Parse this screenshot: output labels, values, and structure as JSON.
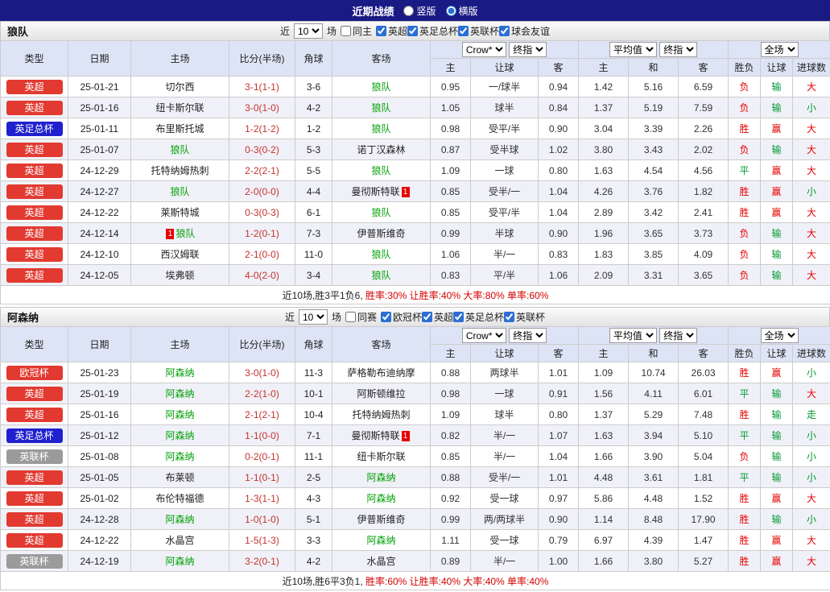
{
  "topbar": {
    "title": "近期战绩",
    "layout_options": [
      {
        "label": "竖版",
        "selected": false
      },
      {
        "label": "横版",
        "selected": true
      }
    ]
  },
  "palette": {
    "red": "#e60000",
    "green": "#009933",
    "badge_red": "#e23a31",
    "badge_blue": "#2020cf",
    "badge_gray": "#9b9b9b",
    "focus_team_green": "#00a006",
    "score_red": "#c5322d",
    "topbar_bg": "#1a1a85",
    "green_values": [
      "平",
      "输",
      "小",
      "走"
    ]
  },
  "columns": {
    "type": "类型",
    "date": "日期",
    "home": "主场",
    "score": "比分(半场)",
    "corner": "角球",
    "away": "客场",
    "sub": [
      "主",
      "让球",
      "客",
      "主",
      "和",
      "客",
      "胜负",
      "让球",
      "进球数"
    ],
    "selects": {
      "odds": "Crow*",
      "odds_final": "终指",
      "avg": "平均值",
      "avg_final": "终指",
      "full": "全场"
    }
  },
  "sections": [
    {
      "team": "狼队",
      "filters": {
        "prefix": "近",
        "count": "10",
        "suffix": "场",
        "same": {
          "label": "同主",
          "checked": false
        },
        "leagues": [
          {
            "label": "英超",
            "checked": true
          },
          {
            "label": "英足总杯",
            "checked": true
          },
          {
            "label": "英联杯",
            "checked": true
          },
          {
            "label": "球会友谊",
            "checked": true
          }
        ]
      },
      "rows": [
        {
          "league": "英超",
          "badge": "red",
          "date": "25-01-21",
          "home": "切尔西",
          "home_focus": false,
          "score": "3-1(1-1)",
          "corner": "3-6",
          "away": "狼队",
          "away_focus": true,
          "odds": [
            "0.95",
            "一/球半",
            "0.94"
          ],
          "avg": [
            "1.42",
            "5.16",
            "6.59"
          ],
          "results": [
            "负",
            "输",
            "大"
          ]
        },
        {
          "league": "英超",
          "badge": "red",
          "date": "25-01-16",
          "home": "纽卡斯尔联",
          "home_focus": false,
          "score": "3-0(1-0)",
          "corner": "4-2",
          "away": "狼队",
          "away_focus": true,
          "odds": [
            "1.05",
            "球半",
            "0.84"
          ],
          "avg": [
            "1.37",
            "5.19",
            "7.59"
          ],
          "results": [
            "负",
            "输",
            "小"
          ]
        },
        {
          "league": "英足总杯",
          "badge": "blue",
          "date": "25-01-11",
          "home": "布里斯托城",
          "home_focus": false,
          "score": "1-2(1-2)",
          "corner": "1-2",
          "away": "狼队",
          "away_focus": true,
          "odds": [
            "0.98",
            "受平/半",
            "0.90"
          ],
          "avg": [
            "3.04",
            "3.39",
            "2.26"
          ],
          "results": [
            "胜",
            "赢",
            "大"
          ]
        },
        {
          "league": "英超",
          "badge": "red",
          "date": "25-01-07",
          "home": "狼队",
          "home_focus": true,
          "score": "0-3(0-2)",
          "corner": "5-3",
          "away": "诺丁汉森林",
          "away_focus": false,
          "odds": [
            "0.87",
            "受半球",
            "1.02"
          ],
          "avg": [
            "3.80",
            "3.43",
            "2.02"
          ],
          "results": [
            "负",
            "输",
            "大"
          ]
        },
        {
          "league": "英超",
          "badge": "red",
          "date": "24-12-29",
          "home": "托特纳姆热刺",
          "home_focus": false,
          "score": "2-2(2-1)",
          "corner": "5-5",
          "away": "狼队",
          "away_focus": true,
          "odds": [
            "1.09",
            "一球",
            "0.80"
          ],
          "avg": [
            "1.63",
            "4.54",
            "4.56"
          ],
          "results": [
            "平",
            "赢",
            "大"
          ]
        },
        {
          "league": "英超",
          "badge": "red",
          "date": "24-12-27",
          "home": "狼队",
          "home_focus": true,
          "score": "2-0(0-0)",
          "corner": "4-4",
          "away": "曼彻斯特联",
          "away_focus": false,
          "away_card": true,
          "odds": [
            "0.85",
            "受半/一",
            "1.04"
          ],
          "avg": [
            "4.26",
            "3.76",
            "1.82"
          ],
          "results": [
            "胜",
            "赢",
            "小"
          ]
        },
        {
          "league": "英超",
          "badge": "red",
          "date": "24-12-22",
          "home": "莱斯特城",
          "home_focus": false,
          "score": "0-3(0-3)",
          "corner": "6-1",
          "away": "狼队",
          "away_focus": true,
          "odds": [
            "0.85",
            "受平/半",
            "1.04"
          ],
          "avg": [
            "2.89",
            "3.42",
            "2.41"
          ],
          "results": [
            "胜",
            "赢",
            "大"
          ]
        },
        {
          "league": "英超",
          "badge": "red",
          "date": "24-12-14",
          "home": "狼队",
          "home_focus": true,
          "home_card_pre": true,
          "score": "1-2(0-1)",
          "corner": "7-3",
          "away": "伊普斯维奇",
          "away_focus": false,
          "odds": [
            "0.99",
            "半球",
            "0.90"
          ],
          "avg": [
            "1.96",
            "3.65",
            "3.73"
          ],
          "results": [
            "负",
            "输",
            "大"
          ]
        },
        {
          "league": "英超",
          "badge": "red",
          "date": "24-12-10",
          "home": "西汉姆联",
          "home_focus": false,
          "score": "2-1(0-0)",
          "corner": "11-0",
          "away": "狼队",
          "away_focus": true,
          "odds": [
            "1.06",
            "半/一",
            "0.83"
          ],
          "avg": [
            "1.83",
            "3.85",
            "4.09"
          ],
          "results": [
            "负",
            "输",
            "大"
          ]
        },
        {
          "league": "英超",
          "badge": "red",
          "date": "24-12-05",
          "home": "埃弗顿",
          "home_focus": false,
          "score": "4-0(2-0)",
          "corner": "3-4",
          "away": "狼队",
          "away_focus": true,
          "odds": [
            "0.83",
            "平/半",
            "1.06"
          ],
          "avg": [
            "2.09",
            "3.31",
            "3.65"
          ],
          "results": [
            "负",
            "输",
            "大"
          ]
        }
      ],
      "summary": [
        {
          "text": "近10场,胜3平1负6, ",
          "red": false
        },
        {
          "text": "胜率:30% ",
          "red": true
        },
        {
          "text": "让胜率:40% ",
          "red": true
        },
        {
          "text": "大率:80% ",
          "red": true
        },
        {
          "text": "单率:60%",
          "red": true
        }
      ]
    },
    {
      "team": "阿森纳",
      "filters": {
        "prefix": "近",
        "count": "10",
        "suffix": "场",
        "same": {
          "label": "同赛",
          "checked": false
        },
        "leagues": [
          {
            "label": "欧冠杯",
            "checked": true
          },
          {
            "label": "英超",
            "checked": true
          },
          {
            "label": "英足总杯",
            "checked": true
          },
          {
            "label": "英联杯",
            "checked": true
          }
        ]
      },
      "rows": [
        {
          "league": "欧冠杯",
          "badge": "red",
          "date": "25-01-23",
          "home": "阿森纳",
          "home_focus": true,
          "score": "3-0(1-0)",
          "corner": "11-3",
          "away": "萨格勒布迪纳摩",
          "away_focus": false,
          "odds": [
            "0.88",
            "两球半",
            "1.01"
          ],
          "avg": [
            "1.09",
            "10.74",
            "26.03"
          ],
          "results": [
            "胜",
            "赢",
            "小"
          ]
        },
        {
          "league": "英超",
          "badge": "red",
          "date": "25-01-19",
          "home": "阿森纳",
          "home_focus": true,
          "score": "2-2(1-0)",
          "corner": "10-1",
          "away": "阿斯顿维拉",
          "away_focus": false,
          "odds": [
            "0.98",
            "一球",
            "0.91"
          ],
          "avg": [
            "1.56",
            "4.11",
            "6.01"
          ],
          "results": [
            "平",
            "输",
            "大"
          ]
        },
        {
          "league": "英超",
          "badge": "red",
          "date": "25-01-16",
          "home": "阿森纳",
          "home_focus": true,
          "score": "2-1(2-1)",
          "corner": "10-4",
          "away": "托特纳姆热刺",
          "away_focus": false,
          "odds": [
            "1.09",
            "球半",
            "0.80"
          ],
          "avg": [
            "1.37",
            "5.29",
            "7.48"
          ],
          "results": [
            "胜",
            "输",
            "走"
          ]
        },
        {
          "league": "英足总杯",
          "badge": "blue",
          "date": "25-01-12",
          "home": "阿森纳",
          "home_focus": true,
          "score": "1-1(0-0)",
          "corner": "7-1",
          "away": "曼彻斯特联",
          "away_focus": false,
          "away_card": true,
          "odds": [
            "0.82",
            "半/一",
            "1.07"
          ],
          "avg": [
            "1.63",
            "3.94",
            "5.10"
          ],
          "results": [
            "平",
            "输",
            "小"
          ]
        },
        {
          "league": "英联杯",
          "badge": "gray",
          "date": "25-01-08",
          "home": "阿森纳",
          "home_focus": true,
          "score": "0-2(0-1)",
          "corner": "11-1",
          "away": "纽卡斯尔联",
          "away_focus": false,
          "odds": [
            "0.85",
            "半/一",
            "1.04"
          ],
          "avg": [
            "1.66",
            "3.90",
            "5.04"
          ],
          "results": [
            "负",
            "输",
            "小"
          ]
        },
        {
          "league": "英超",
          "badge": "red",
          "date": "25-01-05",
          "home": "布莱顿",
          "home_focus": false,
          "score": "1-1(0-1)",
          "corner": "2-5",
          "away": "阿森纳",
          "away_focus": true,
          "odds": [
            "0.88",
            "受半/一",
            "1.01"
          ],
          "avg": [
            "4.48",
            "3.61",
            "1.81"
          ],
          "results": [
            "平",
            "输",
            "小"
          ]
        },
        {
          "league": "英超",
          "badge": "red",
          "date": "25-01-02",
          "home": "布伦特福德",
          "home_focus": false,
          "score": "1-3(1-1)",
          "corner": "4-3",
          "away": "阿森纳",
          "away_focus": true,
          "odds": [
            "0.92",
            "受一球",
            "0.97"
          ],
          "avg": [
            "5.86",
            "4.48",
            "1.52"
          ],
          "results": [
            "胜",
            "赢",
            "大"
          ]
        },
        {
          "league": "英超",
          "badge": "red",
          "date": "24-12-28",
          "home": "阿森纳",
          "home_focus": true,
          "score": "1-0(1-0)",
          "corner": "5-1",
          "away": "伊普斯维奇",
          "away_focus": false,
          "odds": [
            "0.99",
            "两/两球半",
            "0.90"
          ],
          "avg": [
            "1.14",
            "8.48",
            "17.90"
          ],
          "results": [
            "胜",
            "输",
            "小"
          ]
        },
        {
          "league": "英超",
          "badge": "red",
          "date": "24-12-22",
          "home": "水晶宫",
          "home_focus": false,
          "score": "1-5(1-3)",
          "corner": "3-3",
          "away": "阿森纳",
          "away_focus": true,
          "odds": [
            "1.11",
            "受一球",
            "0.79"
          ],
          "avg": [
            "6.97",
            "4.39",
            "1.47"
          ],
          "results": [
            "胜",
            "赢",
            "大"
          ]
        },
        {
          "league": "英联杯",
          "badge": "gray",
          "date": "24-12-19",
          "home": "阿森纳",
          "home_focus": true,
          "score": "3-2(0-1)",
          "corner": "4-2",
          "away": "水晶宫",
          "away_focus": false,
          "odds": [
            "0.89",
            "半/一",
            "1.00"
          ],
          "avg": [
            "1.66",
            "3.80",
            "5.27"
          ],
          "results": [
            "胜",
            "赢",
            "大"
          ]
        }
      ],
      "summary": [
        {
          "text": "近10场,胜6平3负1, ",
          "red": false
        },
        {
          "text": "胜率:60% ",
          "red": true
        },
        {
          "text": "让胜率:40% ",
          "red": true
        },
        {
          "text": "大率:40% ",
          "red": true
        },
        {
          "text": "单率:40%",
          "red": true
        }
      ]
    }
  ]
}
